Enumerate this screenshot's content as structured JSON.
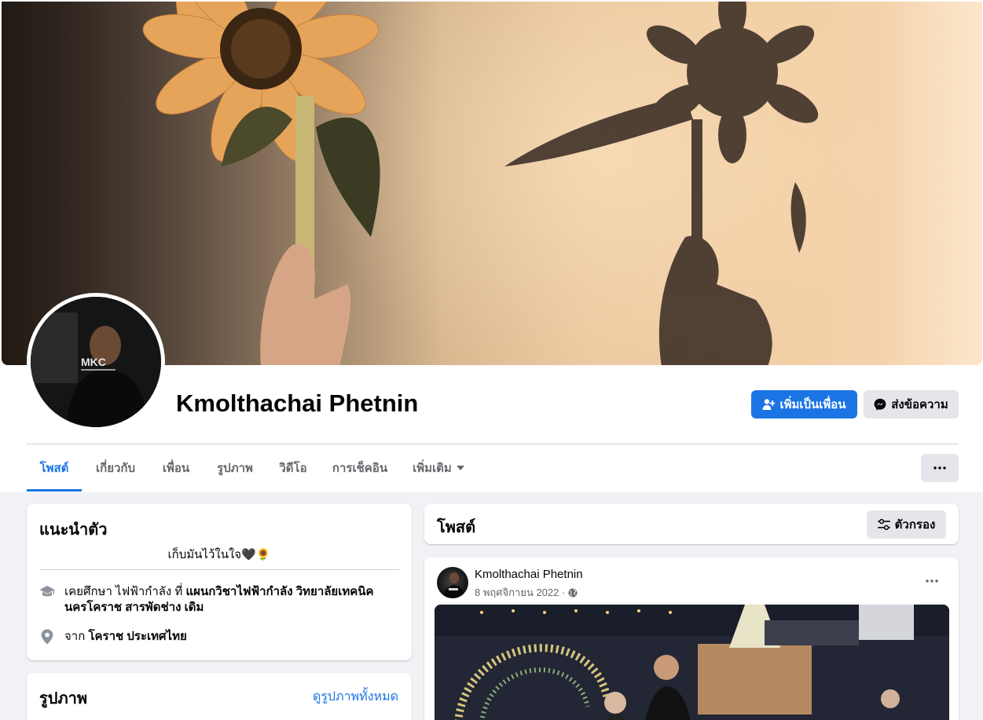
{
  "profile": {
    "name": "Kmolthachai Phetnin"
  },
  "actions": {
    "add_friend": "เพิ่มเป็นเพื่อน",
    "message": "ส่งข้อความ"
  },
  "tabs": [
    {
      "label": "โพสต์",
      "active": true
    },
    {
      "label": "เกี่ยวกับ",
      "active": false
    },
    {
      "label": "เพื่อน",
      "active": false
    },
    {
      "label": "รูปภาพ",
      "active": false
    },
    {
      "label": "วิดีโอ",
      "active": false
    },
    {
      "label": "การเช็คอิน",
      "active": false
    },
    {
      "label": "เพิ่มเติม",
      "active": false
    }
  ],
  "intro": {
    "title": "แนะนำตัว",
    "bio": "เก็บมันไว้ในใจ🖤🌻",
    "education": {
      "prefix": "เคยศึกษา ไฟฟ้ากำลัง ที่",
      "school": "แผนกวิชาไฟฟ้ากำลัง วิทยาลัยเทคนิคนครโคราช สารพัดช่าง เดิม"
    },
    "hometown": {
      "prefix": "จาก",
      "place": "โคราช ประเทศไทย"
    }
  },
  "photos": {
    "title": "รูปภาพ",
    "see_all": "ดูรูปภาพทั้งหมด"
  },
  "posts": {
    "title": "โพสต์",
    "filter": "ตัวกรอง"
  },
  "post": {
    "author": "Kmolthachai Phetnin",
    "date": "8 พฤศจิกายน 2022 ·"
  },
  "icons": {
    "add_friend": "add-friend-icon",
    "messenger": "messenger-icon",
    "education": "graduation-cap-icon",
    "location": "location-pin-icon",
    "filter": "sliders-icon",
    "audience": "globe-icon",
    "more": "more-horizontal-icon"
  },
  "colors": {
    "primary": "#1b74e4",
    "background": "#f0f2f5",
    "secondary_button": "#e4e6eb",
    "muted_text": "#65676b"
  }
}
